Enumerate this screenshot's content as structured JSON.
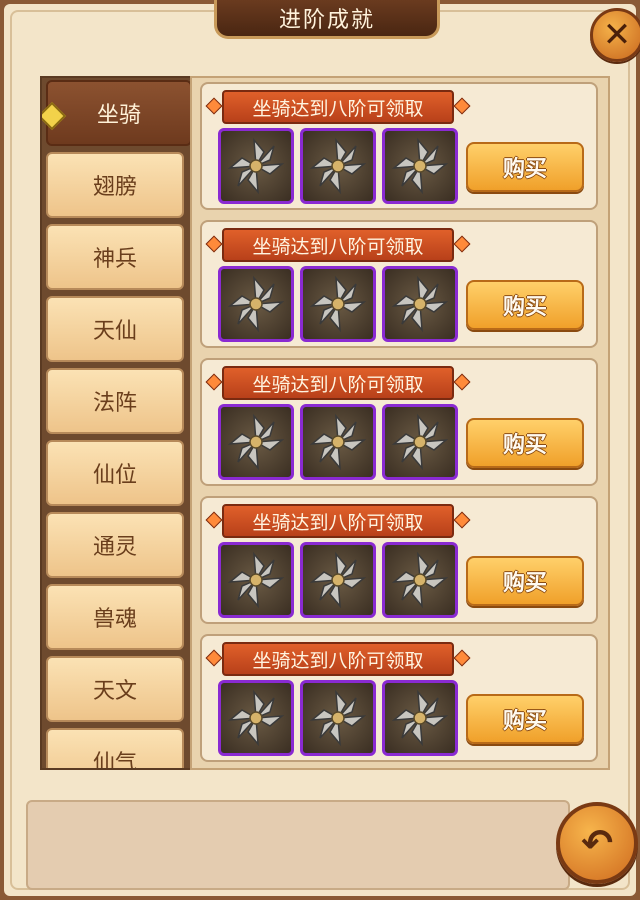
{
  "window": {
    "title": "进阶成就",
    "close_icon": "close-icon",
    "close_label": "✕"
  },
  "sidebar": {
    "tabs": [
      {
        "label": "坐骑",
        "active": true
      },
      {
        "label": "翅膀",
        "active": false
      },
      {
        "label": "神兵",
        "active": false
      },
      {
        "label": "天仙",
        "active": false
      },
      {
        "label": "法阵",
        "active": false
      },
      {
        "label": "仙位",
        "active": false
      },
      {
        "label": "通灵",
        "active": false
      },
      {
        "label": "兽魂",
        "active": false
      },
      {
        "label": "天文",
        "active": false
      },
      {
        "label": "仙气",
        "active": false
      }
    ]
  },
  "achievements": [
    {
      "requirement": "坐骑达到八阶可领取",
      "items": [
        "shuriken-icon",
        "shuriken-icon",
        "shuriken-icon"
      ],
      "button": "购买"
    },
    {
      "requirement": "坐骑达到八阶可领取",
      "items": [
        "shuriken-icon",
        "shuriken-icon",
        "shuriken-icon"
      ],
      "button": "购买"
    },
    {
      "requirement": "坐骑达到八阶可领取",
      "items": [
        "shuriken-icon",
        "shuriken-icon",
        "shuriken-icon"
      ],
      "button": "购买"
    },
    {
      "requirement": "坐骑达到八阶可领取",
      "items": [
        "shuriken-icon",
        "shuriken-icon",
        "shuriken-icon"
      ],
      "button": "购买"
    },
    {
      "requirement": "坐骑达到八阶可领取",
      "items": [
        "shuriken-icon",
        "shuriken-icon",
        "shuriken-icon"
      ],
      "button": "购买"
    }
  ],
  "footer": {
    "back_icon": "back-arrow-icon",
    "back_label": "↶"
  },
  "colors": {
    "frame": "#8a5a36",
    "panel": "#f3e5c9",
    "item_border": "#8a2ad2",
    "button": "#f0a02a",
    "banner": "#c8481e"
  }
}
